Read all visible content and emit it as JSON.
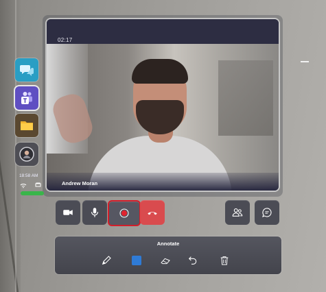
{
  "call": {
    "timer": "02:17",
    "caller_name": "Andrew Moran"
  },
  "status": {
    "time": "18:58 AM"
  },
  "apps": [
    {
      "name": "chat-app",
      "icon": "chat-bubbles-icon"
    },
    {
      "name": "teams-app",
      "icon": "teams-icon"
    },
    {
      "name": "files-app",
      "icon": "folder-icon"
    },
    {
      "name": "profile-app",
      "icon": "user-avatar-icon"
    }
  ],
  "controls": {
    "camera_icon": "video-camera-icon",
    "mic_icon": "microphone-icon",
    "record_icon": "record-icon",
    "hangup_icon": "hang-up-icon",
    "people_icon": "participants-icon",
    "chat_icon": "chat-icon"
  },
  "annotate": {
    "title": "Annotate",
    "selected_color": "#2f7bd6",
    "tools": [
      "pen-icon",
      "color-swatch",
      "eraser-icon",
      "undo-icon",
      "delete-icon"
    ]
  },
  "colors": {
    "record_highlight": "#d21e2a",
    "hangup": "#d94b4e",
    "battery": "#39b54a",
    "teams": "#5f4fc2"
  }
}
